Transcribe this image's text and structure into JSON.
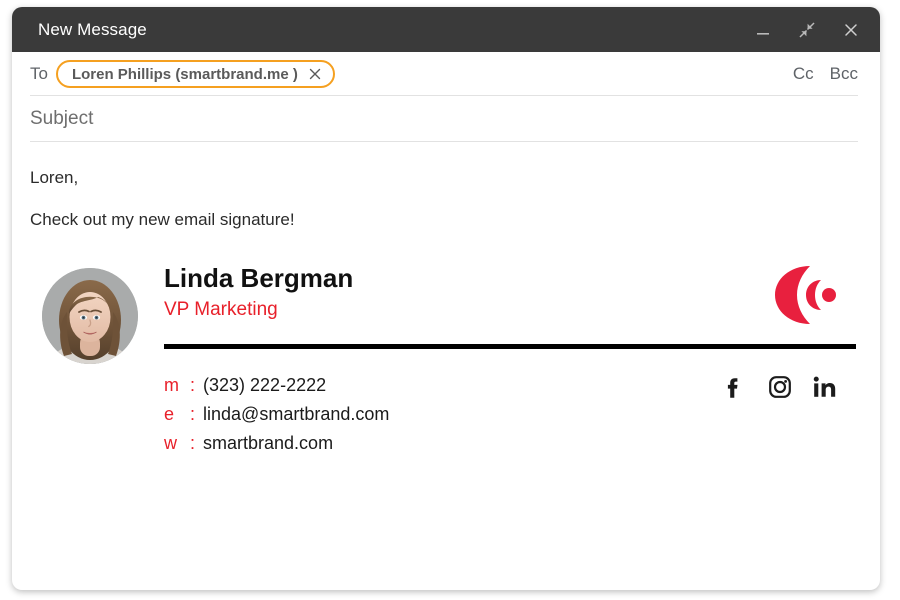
{
  "window": {
    "title": "New Message",
    "controls": [
      {
        "name": "minimize",
        "icon": "minimize-icon"
      },
      {
        "name": "collapse",
        "icon": "collapse-arrows-icon"
      },
      {
        "name": "close",
        "icon": "close-icon"
      }
    ],
    "titlebar_color": "#3a3a3a"
  },
  "compose": {
    "to_label": "To",
    "recipient": {
      "text": "Loren Phillips (smartbrand.me )",
      "chip_border_color": "#f5a020",
      "remove_icon": "close-icon"
    },
    "cc_label": "Cc",
    "bcc_label": "Bcc",
    "subject_placeholder": "Subject",
    "body": {
      "greeting": "Loren,",
      "line1": "Check out my new email signature!"
    }
  },
  "signature": {
    "avatar_alt": "portrait-photo",
    "name": "Linda Bergman",
    "title": "VP Marketing",
    "title_color": "#e8202a",
    "logo_color": "#e8203e",
    "logo_alt": "smartbrand-logo",
    "contacts": [
      {
        "key": "m",
        "sep": ":",
        "value": "(323) 222-2222"
      },
      {
        "key": "e",
        "sep": ":",
        "value": "linda@smartbrand.com"
      },
      {
        "key": "w",
        "sep": ":",
        "value": "smartbrand.com"
      }
    ],
    "socials": [
      {
        "name": "facebook-icon",
        "label": "f"
      },
      {
        "name": "instagram-icon",
        "label": ""
      },
      {
        "name": "linkedin-icon",
        "label": "in"
      }
    ]
  }
}
